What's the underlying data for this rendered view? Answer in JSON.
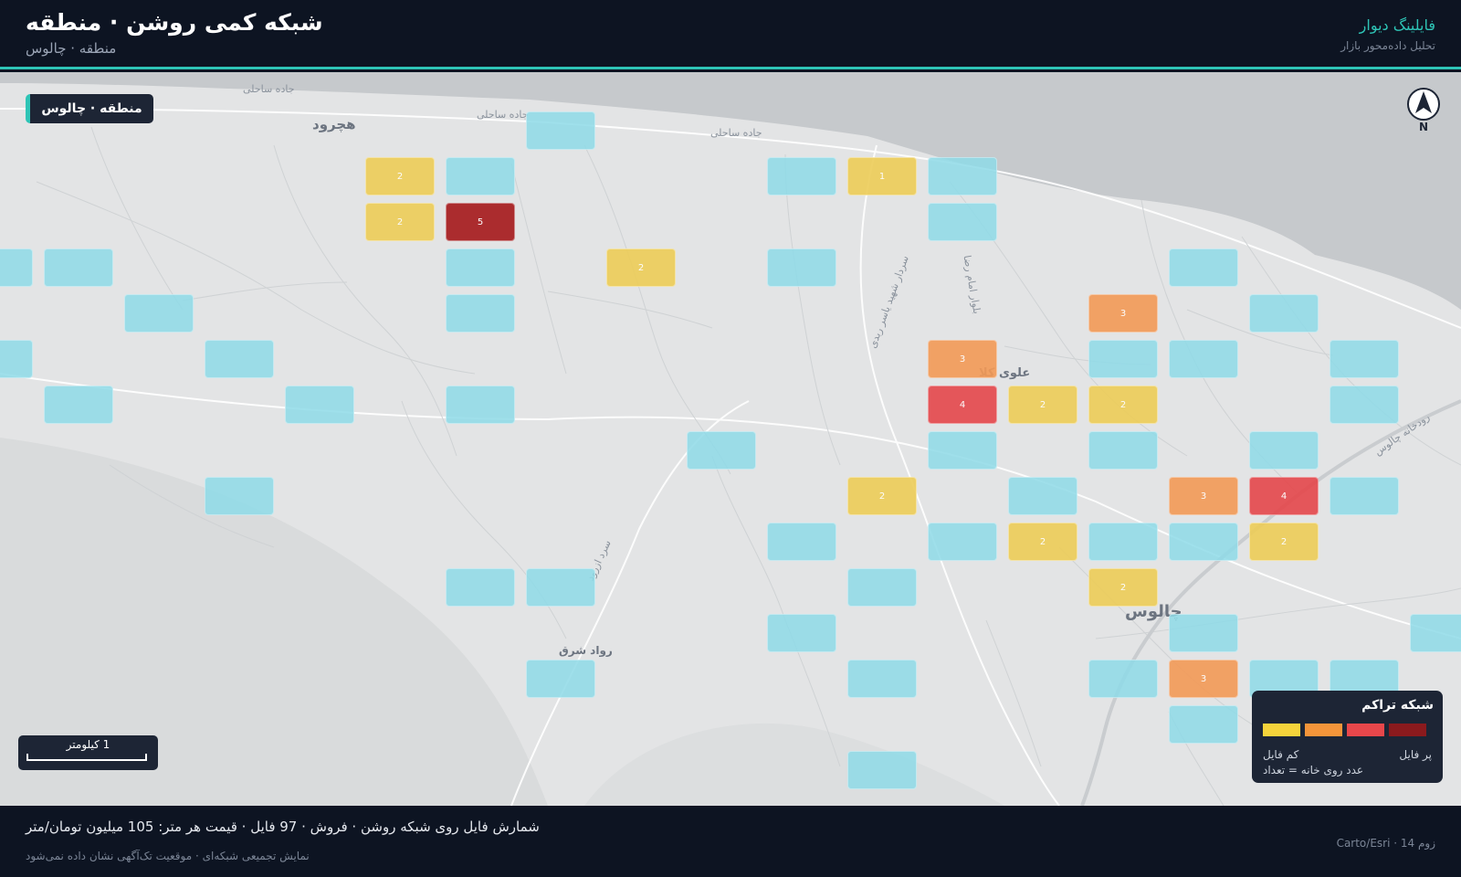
{
  "header": {
    "title": "شبکه کمی روشن · منطقه",
    "subtitle": "منطقه · چالوس",
    "brand": "فایلینگ دیوار",
    "tagline": "تحلیل داده‌محور بازار"
  },
  "map": {
    "region_label": "منطقه · چالوس",
    "north_label": "N",
    "scale_label": "1 کیلومتر",
    "places": [
      {
        "name": "هچرود",
        "size": 15
      },
      {
        "name": "علوی کلا",
        "size": 13
      },
      {
        "name": "چالوس",
        "size": 18
      },
      {
        "name": "رواد شرق",
        "size": 12
      }
    ],
    "roads": [
      "جاده ساحلی",
      "جاده ساحلی",
      "جاده ساحلی",
      "سردار شهید یاسر ربدی",
      "بلوار امام رضا",
      "رودخانه چالوس",
      "سرد ازرود"
    ],
    "colors": {
      "empty": "#8fdbe8",
      "level2": "#edcd58",
      "level3": "#f39a57",
      "level4": "#e5474b",
      "level5": "#a5191b",
      "sea": "#c6c9cc",
      "land": "#e3e4e5",
      "accent": "#2ec4b6"
    },
    "grid": [
      {
        "row": 0,
        "col": 6,
        "count": null
      },
      {
        "row": 1,
        "col": 4,
        "count": 2
      },
      {
        "row": 1,
        "col": 5,
        "count": null
      },
      {
        "row": 1,
        "col": 9,
        "count": null
      },
      {
        "row": 1,
        "col": 10,
        "count": 1
      },
      {
        "row": 1,
        "col": 11,
        "count": null
      },
      {
        "row": 2,
        "col": 4,
        "count": 2
      },
      {
        "row": 2,
        "col": 5,
        "count": 5
      },
      {
        "row": 2,
        "col": 11,
        "count": null
      },
      {
        "row": 3,
        "col": -1,
        "count": null
      },
      {
        "row": 3,
        "col": 0,
        "count": null
      },
      {
        "row": 3,
        "col": 5,
        "count": null
      },
      {
        "row": 3,
        "col": 7,
        "count": 2
      },
      {
        "row": 3,
        "col": 9,
        "count": null
      },
      {
        "row": 3,
        "col": 14,
        "count": null
      },
      {
        "row": 4,
        "col": 1,
        "count": null
      },
      {
        "row": 4,
        "col": 5,
        "count": null
      },
      {
        "row": 4,
        "col": 13,
        "count": 3
      },
      {
        "row": 4,
        "col": 15,
        "count": null
      },
      {
        "row": 5,
        "col": -1,
        "count": null
      },
      {
        "row": 5,
        "col": 2,
        "count": null
      },
      {
        "row": 5,
        "col": 11,
        "count": 3
      },
      {
        "row": 5,
        "col": 13,
        "count": null
      },
      {
        "row": 5,
        "col": 14,
        "count": null
      },
      {
        "row": 5,
        "col": 16,
        "count": null
      },
      {
        "row": 6,
        "col": 0,
        "count": null
      },
      {
        "row": 6,
        "col": 3,
        "count": null
      },
      {
        "row": 6,
        "col": 5,
        "count": null
      },
      {
        "row": 6,
        "col": 11,
        "count": 4
      },
      {
        "row": 6,
        "col": 12,
        "count": 2
      },
      {
        "row": 6,
        "col": 13,
        "count": 2
      },
      {
        "row": 6,
        "col": 16,
        "count": null
      },
      {
        "row": 7,
        "col": 8,
        "count": null
      },
      {
        "row": 7,
        "col": 11,
        "count": null
      },
      {
        "row": 7,
        "col": 13,
        "count": null
      },
      {
        "row": 7,
        "col": 15,
        "count": null
      },
      {
        "row": 8,
        "col": 2,
        "count": null
      },
      {
        "row": 8,
        "col": 10,
        "count": 2
      },
      {
        "row": 8,
        "col": 12,
        "count": null
      },
      {
        "row": 8,
        "col": 14,
        "count": 3
      },
      {
        "row": 8,
        "col": 15,
        "count": 4
      },
      {
        "row": 8,
        "col": 16,
        "count": null
      },
      {
        "row": 9,
        "col": 9,
        "count": null
      },
      {
        "row": 9,
        "col": 11,
        "count": null
      },
      {
        "row": 9,
        "col": 12,
        "count": 2
      },
      {
        "row": 9,
        "col": 13,
        "count": null
      },
      {
        "row": 9,
        "col": 14,
        "count": null
      },
      {
        "row": 9,
        "col": 15,
        "count": 2
      },
      {
        "row": 10,
        "col": 5,
        "count": null
      },
      {
        "row": 10,
        "col": 6,
        "count": null
      },
      {
        "row": 10,
        "col": 10,
        "count": null
      },
      {
        "row": 10,
        "col": 13,
        "count": 2
      },
      {
        "row": 11,
        "col": 9,
        "count": null
      },
      {
        "row": 11,
        "col": 14,
        "count": null
      },
      {
        "row": 11,
        "col": 17,
        "count": null
      },
      {
        "row": 12,
        "col": 6,
        "count": null
      },
      {
        "row": 12,
        "col": 10,
        "count": null
      },
      {
        "row": 12,
        "col": 13,
        "count": null
      },
      {
        "row": 12,
        "col": 14,
        "count": 3
      },
      {
        "row": 12,
        "col": 15,
        "count": null
      },
      {
        "row": 12,
        "col": 16,
        "count": null
      },
      {
        "row": 13,
        "col": 14,
        "count": null
      },
      {
        "row": 14,
        "col": 10,
        "count": null
      }
    ]
  },
  "legend": {
    "title": "شبکه تراکم",
    "low_label": "کم فایل",
    "high_label": "پر فایل",
    "note": "عدد روی خانه = تعداد",
    "swatches": [
      "#f5d33b",
      "#f4953a",
      "#e8474b",
      "#8b1a1d"
    ]
  },
  "footer": {
    "stats": "شمارش فایل روی شبکه روشن · فروش · 97 فایل · قیمت هر متر: 105 میلیون تومان/متر",
    "note": "نمایش تجمیعی شبکه‌ای · موقعیت تک‌آگهی نشان داده نمی‌شود",
    "attribution": "زوم 14 · Carto/Esri"
  }
}
